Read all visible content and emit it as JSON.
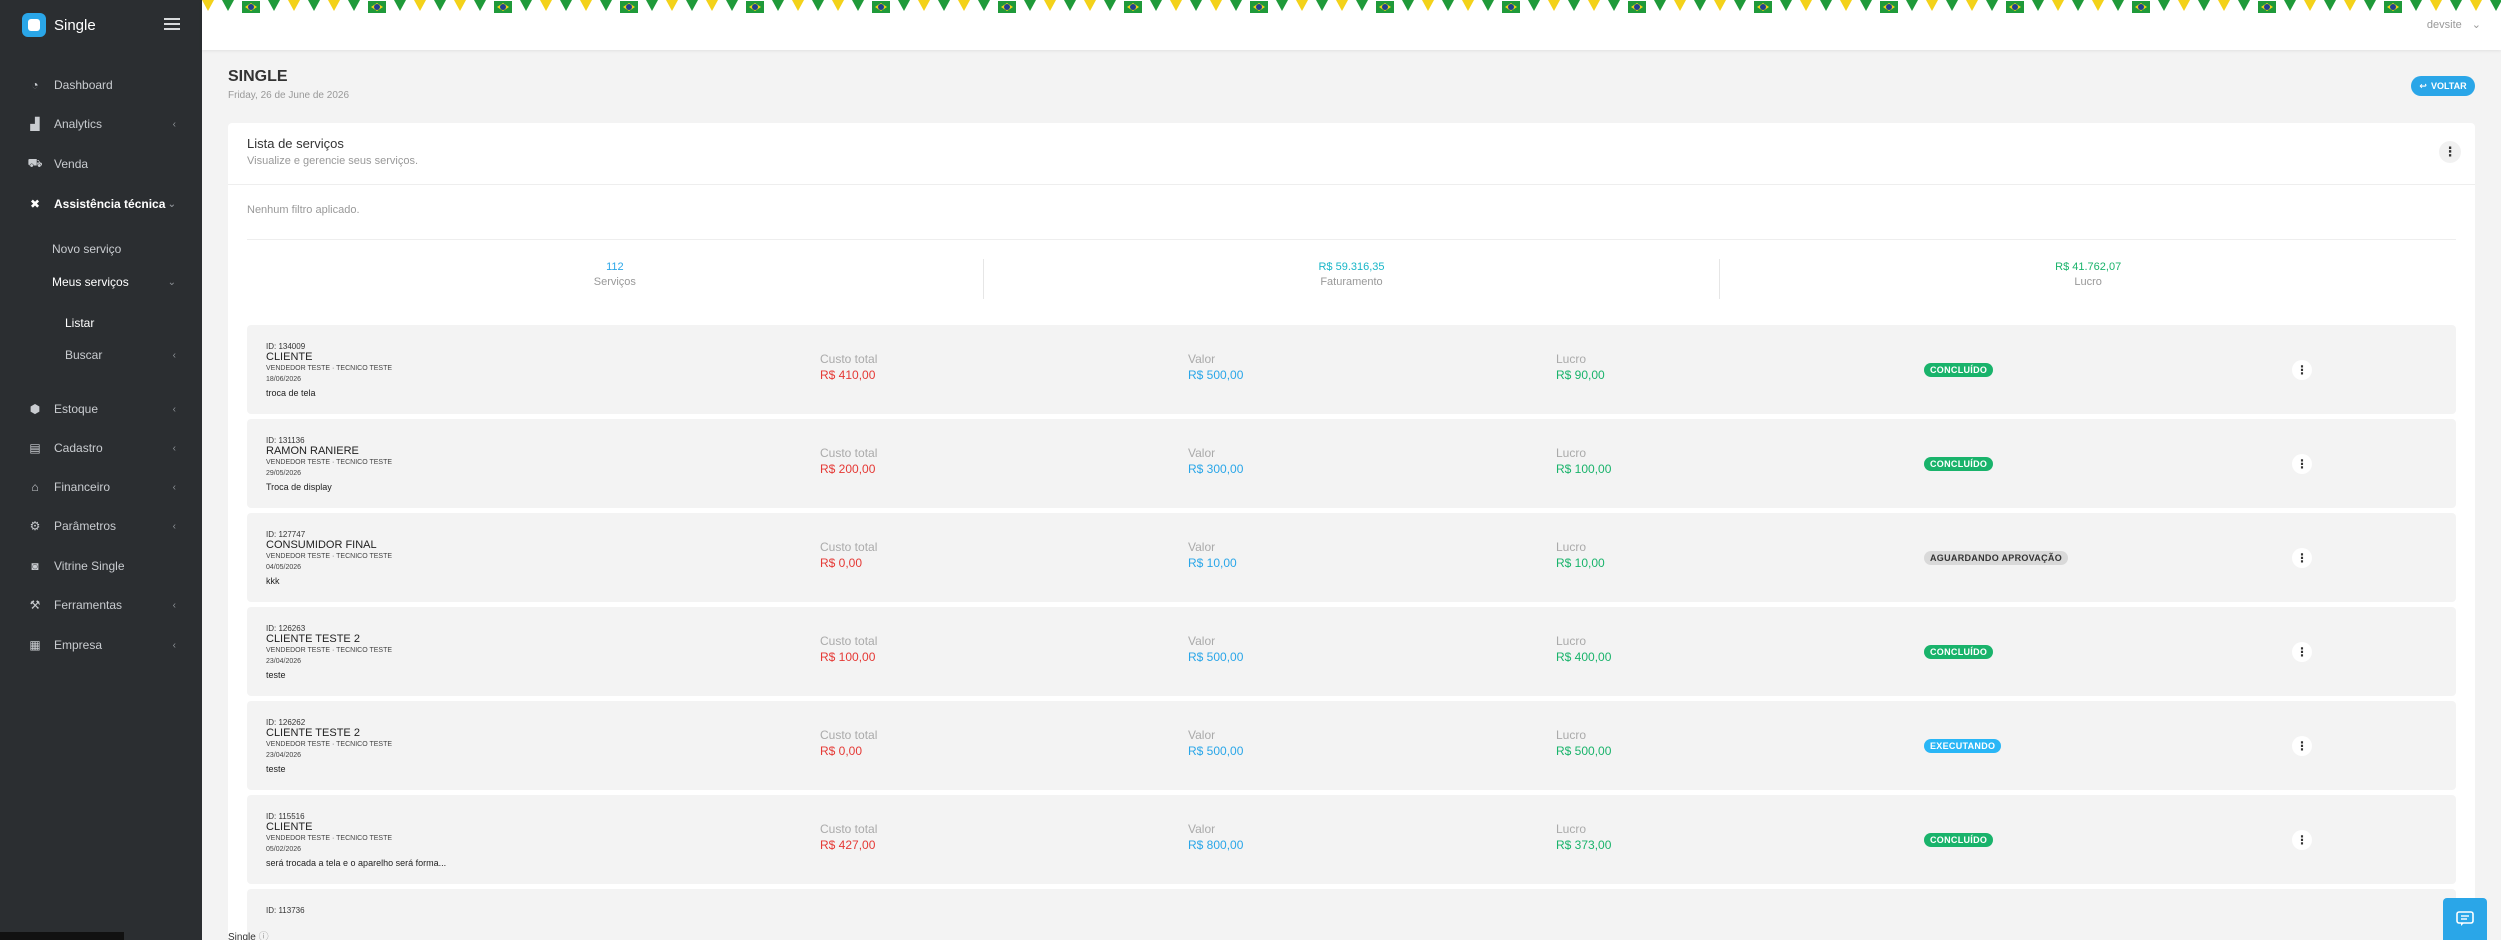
{
  "brand": {
    "name": "Single"
  },
  "colors": {
    "accent": "#2aa6e8",
    "sidebar_bg": "#2b2e31",
    "red": "#e53935",
    "blue": "#2aa6e8",
    "green": "#19b36b",
    "concluido": "#19b36b",
    "executando": "#29b6f6",
    "aguardando": "#d9d9d9"
  },
  "sidebar": {
    "items": [
      {
        "label": "Dashboard",
        "icon": "speedometer-icon",
        "glyph": "◔",
        "chevron": ""
      },
      {
        "label": "Analytics",
        "icon": "chart-icon",
        "glyph": "▟",
        "chevron": "‹"
      },
      {
        "label": "Venda",
        "icon": "cart-icon",
        "glyph": "⛟",
        "chevron": ""
      },
      {
        "label": "Assistência técnica",
        "icon": "tools-icon",
        "glyph": "✖",
        "chevron": "⌄"
      },
      {
        "label": "Estoque",
        "icon": "cubes-icon",
        "glyph": "⬢",
        "chevron": "‹"
      },
      {
        "label": "Cadastro",
        "icon": "id-card-icon",
        "glyph": "▤",
        "chevron": "‹"
      },
      {
        "label": "Financeiro",
        "icon": "bank-icon",
        "glyph": "⌂",
        "chevron": "‹"
      },
      {
        "label": "Parâmetros",
        "icon": "gears-icon",
        "glyph": "⚙",
        "chevron": "‹"
      },
      {
        "label": "Vitrine Single",
        "icon": "bag-icon",
        "glyph": "◙",
        "chevron": ""
      },
      {
        "label": "Ferramentas",
        "icon": "wrench-icon",
        "glyph": "⚒",
        "chevron": "‹"
      },
      {
        "label": "Empresa",
        "icon": "building-icon",
        "glyph": "▦",
        "chevron": "‹"
      }
    ],
    "subitems": {
      "novo_servico": "Novo serviço",
      "meus_servicos": "Meus serviços",
      "listar": "Listar",
      "buscar": "Buscar"
    }
  },
  "topbar": {
    "user": "devsite"
  },
  "header": {
    "title": "SINGLE",
    "date": "Friday, 26 de June de 2026",
    "back_label": "VOLTAR"
  },
  "card": {
    "title": "Lista de serviços",
    "subtitle": "Visualize e gerencie seus serviços.",
    "filters": "Nenhum filtro aplicado."
  },
  "stats": [
    {
      "value": "112",
      "label": "Serviços",
      "color": "#2aa6e8"
    },
    {
      "value": "R$ 59.316,35",
      "label": "Faturamento",
      "color": "#18b6c8"
    },
    {
      "value": "R$ 41.762,07",
      "label": "Lucro",
      "color": "#19b36b"
    }
  ],
  "col_labels": {
    "custo": "Custo total",
    "valor": "Valor",
    "lucro": "Lucro"
  },
  "services": [
    {
      "id": "ID: 134009",
      "client": "CLIENTE",
      "staff": "VENDEDOR TESTE · TECNICO TESTE",
      "date": "18/06/2026",
      "desc": "troca de tela",
      "custo": "R$ 410,00",
      "valor": "R$ 500,00",
      "lucro": "R$ 90,00",
      "status": "CONCLUÍDO",
      "status_kind": "concluido"
    },
    {
      "id": "ID: 131136",
      "client": "RAMON RANIERE",
      "staff": "VENDEDOR TESTE · TECNICO TESTE",
      "date": "29/05/2026",
      "desc": "Troca de display",
      "custo": "R$ 200,00",
      "valor": "R$ 300,00",
      "lucro": "R$ 100,00",
      "status": "CONCLUÍDO",
      "status_kind": "concluido"
    },
    {
      "id": "ID: 127747",
      "client": "CONSUMIDOR FINAL",
      "staff": "VENDEDOR TESTE · TECNICO TESTE",
      "date": "04/05/2026",
      "desc": "kkk",
      "custo": "R$ 0,00",
      "valor": "R$ 10,00",
      "lucro": "R$ 10,00",
      "status": "AGUARDANDO APROVAÇÃO",
      "status_kind": "aguardando"
    },
    {
      "id": "ID: 126263",
      "client": "CLIENTE TESTE 2",
      "staff": "VENDEDOR TESTE · TECNICO TESTE",
      "date": "23/04/2026",
      "desc": "teste",
      "custo": "R$ 100,00",
      "valor": "R$ 500,00",
      "lucro": "R$ 400,00",
      "status": "CONCLUÍDO",
      "status_kind": "concluido"
    },
    {
      "id": "ID: 126262",
      "client": "CLIENTE TESTE 2",
      "staff": "VENDEDOR TESTE · TECNICO TESTE",
      "date": "23/04/2026",
      "desc": "teste",
      "custo": "R$ 0,00",
      "valor": "R$ 500,00",
      "lucro": "R$ 500,00",
      "status": "EXECUTANDO",
      "status_kind": "executando"
    },
    {
      "id": "ID: 115516",
      "client": "CLIENTE",
      "staff": "VENDEDOR TESTE · TECNICO TESTE",
      "date": "05/02/2026",
      "desc": "será trocada a tela e o aparelho será forma...",
      "custo": "R$ 427,00",
      "valor": "R$ 800,00",
      "lucro": "R$ 373,00",
      "status": "CONCLUÍDO",
      "status_kind": "concluido"
    },
    {
      "id": "ID: 113736",
      "client": "",
      "staff": "",
      "date": "",
      "desc": "",
      "custo": "",
      "valor": "",
      "lucro": "",
      "status": "",
      "status_kind": ""
    }
  ],
  "footer": {
    "text": "Single"
  }
}
